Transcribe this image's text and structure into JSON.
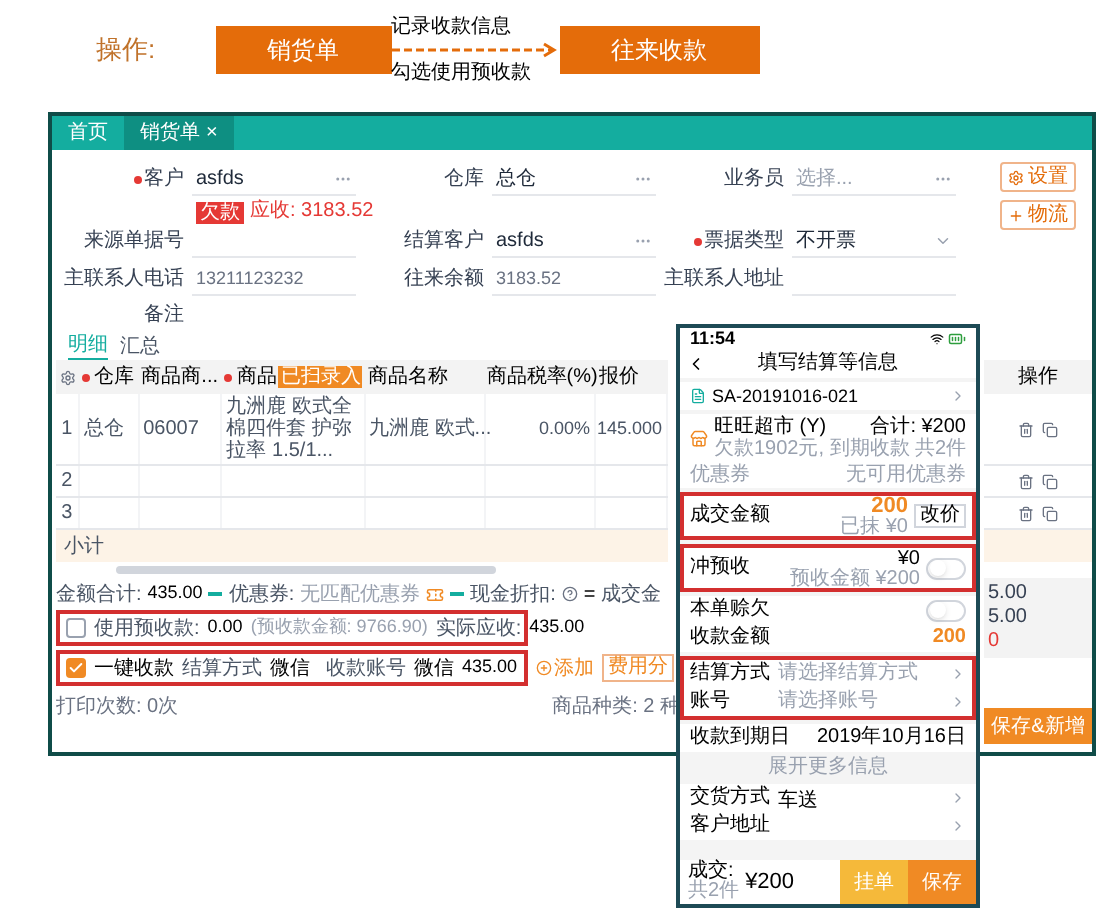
{
  "flow": {
    "label": "操作:",
    "steps": [
      {
        "text": "销货单"
      },
      {
        "text": "往来收款"
      }
    ],
    "notes": [
      "记录收款信息",
      "勾选使用预收款"
    ]
  },
  "app": {
    "tabs": [
      {
        "label": "首页",
        "selected": false
      },
      {
        "label": "销货单",
        "selected": true,
        "close": "×"
      }
    ],
    "form_rows": [
      [
        {
          "label": "客户",
          "value": "asfds",
          "required": true,
          "kind": "lookup"
        },
        {
          "label": "仓库",
          "value": "总仓",
          "required": false,
          "kind": "lookup"
        },
        {
          "label": "业务员",
          "placeholder": "选择...",
          "required": false,
          "kind": "lookup"
        }
      ],
      [
        {
          "label": "来源单据号",
          "required": false,
          "kind": "text"
        },
        {
          "label": "结算客户",
          "value": "asfds",
          "required": false,
          "kind": "lookup"
        },
        {
          "label": "票据类型",
          "value": "不开票",
          "required": true,
          "kind": "select"
        }
      ],
      [
        {
          "label": "主联系人电话",
          "value": "13211123232",
          "required": false,
          "kind": "readonly"
        },
        {
          "label": "往来余额",
          "value": "3183.52",
          "required": false,
          "kind": "readonly"
        },
        {
          "label": "主联系人地址",
          "required": false,
          "kind": "text"
        }
      ]
    ],
    "balance": {
      "tag": "欠款",
      "text": "应收: 3183.52"
    },
    "remark_label": "备注",
    "side_buttons": [
      {
        "label": "设置",
        "kind": "settings"
      },
      {
        "label": "物流",
        "kind": "add"
      }
    ],
    "detail_tabs": [
      {
        "label": "明细",
        "selected": true
      },
      {
        "label": "汇总",
        "selected": false
      }
    ],
    "table": {
      "columns": [
        {
          "label": "仓库",
          "required": true
        },
        {
          "label": "商品商...",
          "required": false
        },
        {
          "label": "商品",
          "required": true,
          "badge": "已扫录入"
        },
        {
          "label": "商品名称",
          "required": false
        },
        {
          "label": "商品税率(%)",
          "required": false
        },
        {
          "label": "报价",
          "required": false
        }
      ],
      "rows": [
        {
          "no": "1",
          "cells": [
            "总仓",
            "06007",
            "九洲鹿 欧式全棉四件套 护弥拉率 1.5/1...",
            "九洲鹿 欧式...",
            "0.00%",
            "145.000"
          ]
        },
        {
          "no": "2"
        },
        {
          "no": "3"
        }
      ],
      "subtotal": "小计"
    },
    "summary": {
      "total_label": "金额合计:",
      "total": "435.00",
      "coupon_label": "优惠券:",
      "coupon_placeholder": "无匹配优惠券",
      "discount_label": "现金折扣:",
      "equals": "=",
      "deal_label": "成交金"
    },
    "prepay": {
      "checked": false,
      "highlighted": true,
      "label": "使用预收款:",
      "amount": "0.00",
      "note": "(预收款金额: 9766.90)",
      "actual_label": "实际应收:",
      "actual": "435.00"
    },
    "quick_pay": {
      "checked": true,
      "highlighted": true,
      "label": "一键收款",
      "method_label": "结算方式",
      "method": "微信",
      "account_label": "收款账号",
      "account": "微信",
      "amount": "435.00",
      "add": "添加",
      "split": "费用分"
    },
    "footer": {
      "print": "打印次数: 0次",
      "kinds": "商品种类: 2 种"
    },
    "right": {
      "header": "操作",
      "values": [
        "5.00",
        "5.00",
        "0"
      ],
      "button": "保存&新增"
    }
  },
  "phone": {
    "time": "11:54",
    "title": "填写结算等信息",
    "order": "SA-20191016-021",
    "customer": {
      "name": "旺旺超市 (Y)",
      "sub": "欠款1902元, 到期收款",
      "total": "合计: ¥200",
      "count": "共2件"
    },
    "coupon": {
      "label": "优惠券",
      "value": "无可用优惠券"
    },
    "deal": {
      "label": "成交金额",
      "value": "200",
      "button": "改价",
      "sub": "已抹 ¥0",
      "highlighted": true
    },
    "prepay": {
      "label": "冲预收",
      "value": "¥0",
      "sub": "预收金额 ¥200",
      "on": false,
      "highlighted": true
    },
    "credit": {
      "label": "本单赊欠",
      "on": false
    },
    "received": {
      "label": "收款金额",
      "value": "200"
    },
    "pay_rows": {
      "highlighted": true,
      "items": [
        {
          "label": "结算方式",
          "placeholder": "请选择结算方式"
        },
        {
          "label": "账号",
          "placeholder": "请选择账号"
        }
      ]
    },
    "due": {
      "label": "收款到期日",
      "value": "2019年10月16日"
    },
    "more": "展开更多信息",
    "extra_rows": [
      {
        "label": "交货方式",
        "value": "车送"
      },
      {
        "label": "客户地址"
      }
    ],
    "bottom": {
      "label": "成交:",
      "amount": "¥200",
      "count": "共2件",
      "buttons": [
        {
          "label": "挂单",
          "kind": "secondary"
        },
        {
          "label": "保存",
          "kind": "primary"
        }
      ]
    }
  }
}
